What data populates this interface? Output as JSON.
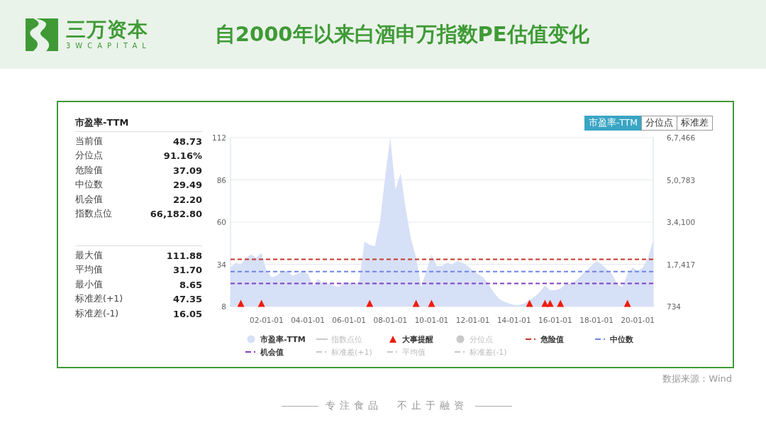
{
  "header": {
    "brand": "三万资本",
    "brand_sub": "3WCAPITAL",
    "title": "自2000年以来白酒申万指数PE估值变化"
  },
  "stats": {
    "title": "市盈率-TTM",
    "groups": [
      [
        {
          "label": "当前值",
          "value": "48.73"
        },
        {
          "label": "分位点",
          "value": "91.16%"
        },
        {
          "label": "危险值",
          "value": "37.09"
        },
        {
          "label": "中位数",
          "value": "29.49"
        },
        {
          "label": "机会值",
          "value": "22.20"
        },
        {
          "label": "指数点位",
          "value": "66,182.80"
        }
      ],
      [
        {
          "label": "最大值",
          "value": "111.88"
        },
        {
          "label": "平均值",
          "value": "31.70"
        },
        {
          "label": "最小值",
          "value": "8.65"
        },
        {
          "label": "标准差(+1)",
          "value": "47.35"
        },
        {
          "label": "标准差(-1)",
          "value": "16.05"
        }
      ]
    ]
  },
  "tabs": [
    {
      "label": "市盈率-TTM",
      "selected": true
    },
    {
      "label": "分位点",
      "selected": false
    },
    {
      "label": "标准差",
      "selected": false
    }
  ],
  "chart": {
    "chart_data": {
      "type": "area",
      "ylim": [
        8,
        112
      ],
      "yticks": [
        8,
        34,
        60,
        86,
        112
      ],
      "categories": [
        null,
        null,
        null,
        null,
        null,
        null,
        null,
        "02-01-01",
        null,
        null,
        null,
        null,
        null,
        null,
        null,
        "04-01-01",
        null,
        null,
        null,
        null,
        null,
        null,
        null,
        "06-01-01",
        null,
        null,
        null,
        null,
        null,
        null,
        null,
        "08-01-01",
        null,
        null,
        null,
        null,
        null,
        null,
        null,
        "10-01-01",
        null,
        null,
        null,
        null,
        null,
        null,
        null,
        "12-01-01",
        null,
        null,
        null,
        null,
        null,
        null,
        null,
        "14-01-01",
        null,
        null,
        null,
        null,
        null,
        null,
        null,
        "16-01-01",
        null,
        null,
        null,
        null,
        null,
        null,
        null,
        "18-01-01",
        null,
        null,
        null,
        null,
        null,
        null,
        null,
        "20-01-01",
        null,
        null,
        null
      ],
      "series": [
        {
          "name": "市盈率-TTM",
          "color": "#d6e0f7",
          "values": [
            32,
            35,
            34,
            38,
            40,
            38,
            41,
            30,
            26,
            27,
            30,
            30,
            27,
            28,
            30,
            28,
            21,
            25,
            22,
            22,
            21,
            20,
            23,
            23,
            21,
            24,
            48,
            46,
            45,
            60,
            88,
            112,
            80,
            90,
            68,
            50,
            38,
            20,
            30,
            40,
            33,
            33,
            35,
            34,
            36,
            35,
            33,
            30,
            28,
            26,
            22,
            17,
            13,
            11,
            10,
            9,
            9,
            10,
            12,
            14,
            17,
            21,
            18,
            18,
            19,
            22,
            22,
            24,
            27,
            30,
            33,
            36,
            34,
            31,
            28,
            22,
            20,
            28,
            32,
            30,
            32,
            38,
            49
          ]
        },
        {
          "name": "大事提醒",
          "type": "scatter",
          "color": "#ee1c0e",
          "values": [
            null,
            null,
            10,
            null,
            null,
            null,
            10,
            null,
            null,
            null,
            null,
            null,
            null,
            null,
            null,
            null,
            null,
            null,
            null,
            null,
            null,
            null,
            null,
            null,
            null,
            null,
            null,
            10,
            null,
            null,
            null,
            null,
            null,
            null,
            null,
            null,
            10,
            null,
            null,
            10,
            null,
            null,
            null,
            null,
            null,
            null,
            null,
            null,
            null,
            null,
            null,
            null,
            null,
            null,
            null,
            null,
            null,
            null,
            10,
            null,
            null,
            10,
            10,
            null,
            10,
            null,
            null,
            null,
            null,
            null,
            null,
            null,
            null,
            null,
            null,
            null,
            null,
            10,
            null,
            null,
            null,
            null,
            null
          ]
        },
        {
          "name": "危险值",
          "type": "line",
          "line_style": "dashed",
          "color": "#c8372a",
          "values": [
            37.1,
            37.1,
            37.1,
            37.1,
            37.1,
            37.1,
            37.1,
            37.1,
            37.1,
            37.1,
            37.1,
            37.1,
            37.1,
            37.1,
            37.1,
            37.1,
            37.1,
            37.1,
            37.1,
            37.1,
            37.1,
            37.1,
            37.1,
            37.1,
            37.1,
            37.1,
            37.1,
            37.1,
            37.1,
            37.1,
            37.1,
            37.1,
            37.1,
            37.1,
            37.1,
            37.1,
            37.1,
            37.1,
            37.1,
            37.1,
            37.1,
            37.1,
            37.1,
            37.1,
            37.1,
            37.1,
            37.1,
            37.1,
            37.1,
            37.1,
            37.1,
            37.1,
            37.1,
            37.1,
            37.1,
            37.1,
            37.1,
            37.1,
            37.1,
            37.1,
            37.1,
            37.1,
            37.1,
            37.1,
            37.1,
            37.1,
            37.1,
            37.1,
            37.1,
            37.1,
            37.1,
            37.1,
            37.1,
            37.1,
            37.1,
            37.1,
            37.1,
            37.1,
            37.1,
            37.1,
            37.1,
            37.1,
            37.1
          ]
        },
        {
          "name": "中位数",
          "type": "line",
          "line_style": "dashed",
          "color": "#6f86e6",
          "values": [
            29.5,
            29.5,
            29.5,
            29.5,
            29.5,
            29.5,
            29.5,
            29.5,
            29.5,
            29.5,
            29.5,
            29.5,
            29.5,
            29.5,
            29.5,
            29.5,
            29.5,
            29.5,
            29.5,
            29.5,
            29.5,
            29.5,
            29.5,
            29.5,
            29.5,
            29.5,
            29.5,
            29.5,
            29.5,
            29.5,
            29.5,
            29.5,
            29.5,
            29.5,
            29.5,
            29.5,
            29.5,
            29.5,
            29.5,
            29.5,
            29.5,
            29.5,
            29.5,
            29.5,
            29.5,
            29.5,
            29.5,
            29.5,
            29.5,
            29.5,
            29.5,
            29.5,
            29.5,
            29.5,
            29.5,
            29.5,
            29.5,
            29.5,
            29.5,
            29.5,
            29.5,
            29.5,
            29.5,
            29.5,
            29.5,
            29.5,
            29.5,
            29.5,
            29.5,
            29.5,
            29.5,
            29.5,
            29.5,
            29.5,
            29.5,
            29.5,
            29.5,
            29.5,
            29.5,
            29.5,
            29.5,
            29.5,
            29.5
          ]
        },
        {
          "name": "机会值",
          "type": "line",
          "line_style": "dashed",
          "color": "#8040c4",
          "values": [
            22.2,
            22.2,
            22.2,
            22.2,
            22.2,
            22.2,
            22.2,
            22.2,
            22.2,
            22.2,
            22.2,
            22.2,
            22.2,
            22.2,
            22.2,
            22.2,
            22.2,
            22.2,
            22.2,
            22.2,
            22.2,
            22.2,
            22.2,
            22.2,
            22.2,
            22.2,
            22.2,
            22.2,
            22.2,
            22.2,
            22.2,
            22.2,
            22.2,
            22.2,
            22.2,
            22.2,
            22.2,
            22.2,
            22.2,
            22.2,
            22.2,
            22.2,
            22.2,
            22.2,
            22.2,
            22.2,
            22.2,
            22.2,
            22.2,
            22.2,
            22.2,
            22.2,
            22.2,
            22.2,
            22.2,
            22.2,
            22.2,
            22.2,
            22.2,
            22.2,
            22.2,
            22.2,
            22.2,
            22.2,
            22.2,
            22.2,
            22.2,
            22.2,
            22.2,
            22.2,
            22.2,
            22.2,
            22.2,
            22.2,
            22.2,
            22.2,
            22.2,
            22.2,
            22.2,
            22.2,
            22.2,
            22.2,
            22.2
          ]
        }
      ]
    },
    "right_axis_ticks": [
      "6,7,466",
      "5,0,783",
      "3,4,100",
      "1,7,417",
      "734"
    ]
  },
  "legend": [
    {
      "kind": "circle",
      "on": true
    },
    {
      "label": "指数点位",
      "kind": "line",
      "on": false
    },
    {
      "kind": "triangle",
      "on": true
    },
    {
      "label": "分位点",
      "kind": "circle",
      "on": false
    },
    {
      "kind": "dashed",
      "on": true
    },
    {
      "kind": "dashed",
      "on": true
    },
    {
      "kind": "dashed",
      "on": true
    },
    {
      "label": "标准差(+1)",
      "kind": "dashed",
      "on": false
    },
    {
      "label": "平均值",
      "kind": "dashed",
      "on": false
    },
    {
      "label": "标准差(-1)",
      "kind": "dashed",
      "on": false
    }
  ],
  "source": "数据来源：Wind",
  "footer": {
    "slogan": "专注食品  不止于融资"
  }
}
